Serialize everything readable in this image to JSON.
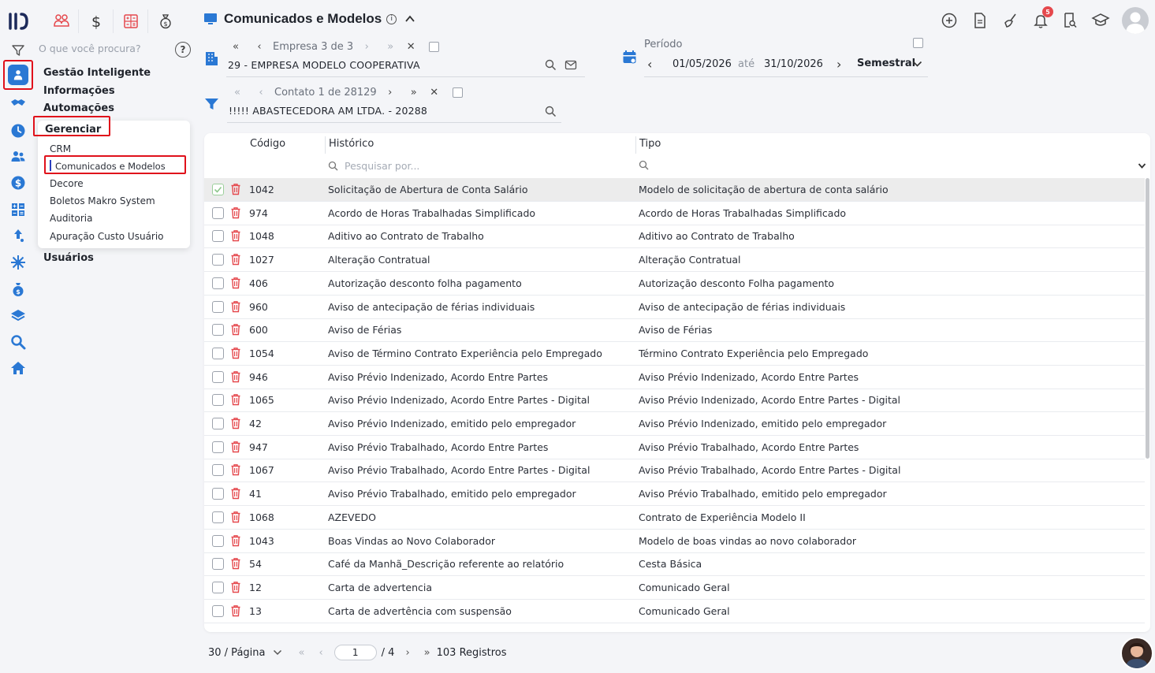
{
  "search": {
    "placeholder": "O que você procura?"
  },
  "help_icon": "?",
  "menu": {
    "sections": [
      "Gestão Inteligente",
      "Informações",
      "Automações",
      "Gerenciar",
      "Usuários"
    ],
    "submenu": [
      "CRM",
      "Comunicados e Modelos",
      "Decore",
      "Boletos Makro System",
      "Auditoria",
      "Apuração Custo Usuário"
    ]
  },
  "header": {
    "title": "Comunicados e Modelos",
    "info": "i"
  },
  "notifications": {
    "count": "5"
  },
  "company": {
    "nav_label": "Empresa",
    "current": "3",
    "of": "de",
    "total": "3",
    "value": "29 - EMPRESA MODELO COOPERATIVA"
  },
  "contact": {
    "nav_label": "Contato",
    "current": "1",
    "of": "de",
    "total": "28129",
    "value": "!!!!! ABASTECEDORA AM LTDA. - 20288"
  },
  "period": {
    "label": "Período",
    "start": "01/05/2026",
    "separator": "até",
    "end": "31/10/2026",
    "mode": "Semestral"
  },
  "table": {
    "columns": [
      "Código",
      "Histórico",
      "Tipo"
    ],
    "filter_placeholder": "Pesquisar por...",
    "rows": [
      {
        "code": "1042",
        "hist": "Solicitação de Abertura de Conta Salário",
        "tipo": "Modelo de solicitação de abertura de conta salário",
        "selected": true
      },
      {
        "code": "974",
        "hist": "Acordo de Horas Trabalhadas Simplificado",
        "tipo": "Acordo de Horas Trabalhadas Simplificado"
      },
      {
        "code": "1048",
        "hist": "Aditivo ao Contrato de Trabalho",
        "tipo": "Aditivo ao Contrato de Trabalho"
      },
      {
        "code": "1027",
        "hist": "Alteração Contratual",
        "tipo": "Alteração Contratual"
      },
      {
        "code": "406",
        "hist": "Autorização desconto folha pagamento",
        "tipo": "Autorização desconto Folha pagamento"
      },
      {
        "code": "960",
        "hist": "Aviso de antecipação de férias individuais",
        "tipo": "Aviso de antecipação de férias individuais"
      },
      {
        "code": "600",
        "hist": "Aviso de Férias",
        "tipo": "Aviso de Férias"
      },
      {
        "code": "1054",
        "hist": "Aviso de Término Contrato Experiência pelo Empregado",
        "tipo": "Término Contrato Experiência pelo Empregado"
      },
      {
        "code": "946",
        "hist": "Aviso Prévio Indenizado, Acordo Entre Partes",
        "tipo": "Aviso Prévio Indenizado, Acordo Entre Partes"
      },
      {
        "code": "1065",
        "hist": "Aviso Prévio Indenizado, Acordo Entre Partes - Digital",
        "tipo": "Aviso Prévio Indenizado, Acordo Entre Partes - Digital"
      },
      {
        "code": "42",
        "hist": "Aviso Prévio Indenizado, emitido pelo empregador",
        "tipo": "Aviso Prévio Indenizado, emitido pelo empregador"
      },
      {
        "code": "947",
        "hist": "Aviso Prévio Trabalhado, Acordo Entre Partes",
        "tipo": "Aviso Prévio Trabalhado, Acordo Entre Partes"
      },
      {
        "code": "1067",
        "hist": "Aviso Prévio Trabalhado, Acordo Entre Partes - Digital",
        "tipo": "Aviso Prévio Trabalhado, Acordo Entre Partes - Digital"
      },
      {
        "code": "41",
        "hist": "Aviso Prévio Trabalhado, emitido pelo empregador",
        "tipo": "Aviso Prévio Trabalhado, emitido pelo empregador"
      },
      {
        "code": "1068",
        "hist": "AZEVEDO",
        "tipo": "Contrato de Experiência Modelo II"
      },
      {
        "code": "1043",
        "hist": "Boas Vindas ao Novo Colaborador",
        "tipo": "Modelo de boas vindas ao novo colaborador"
      },
      {
        "code": "54",
        "hist": "Café da Manhã_Descrição referente ao relatório",
        "tipo": "Cesta Básica"
      },
      {
        "code": "12",
        "hist": "Carta de advertencia",
        "tipo": "Comunicado Geral"
      },
      {
        "code": "13",
        "hist": "Carta de advertência com suspensão",
        "tipo": "Comunicado Geral"
      }
    ]
  },
  "footer": {
    "per_page": "30 / Página",
    "page": "1",
    "total_pages": "/ 4",
    "records": "103 Registros"
  },
  "colors": {
    "accent": "#2a78d4",
    "highlight": "#e0111b",
    "trash": "#e5484d",
    "badge": "#e5484d"
  }
}
